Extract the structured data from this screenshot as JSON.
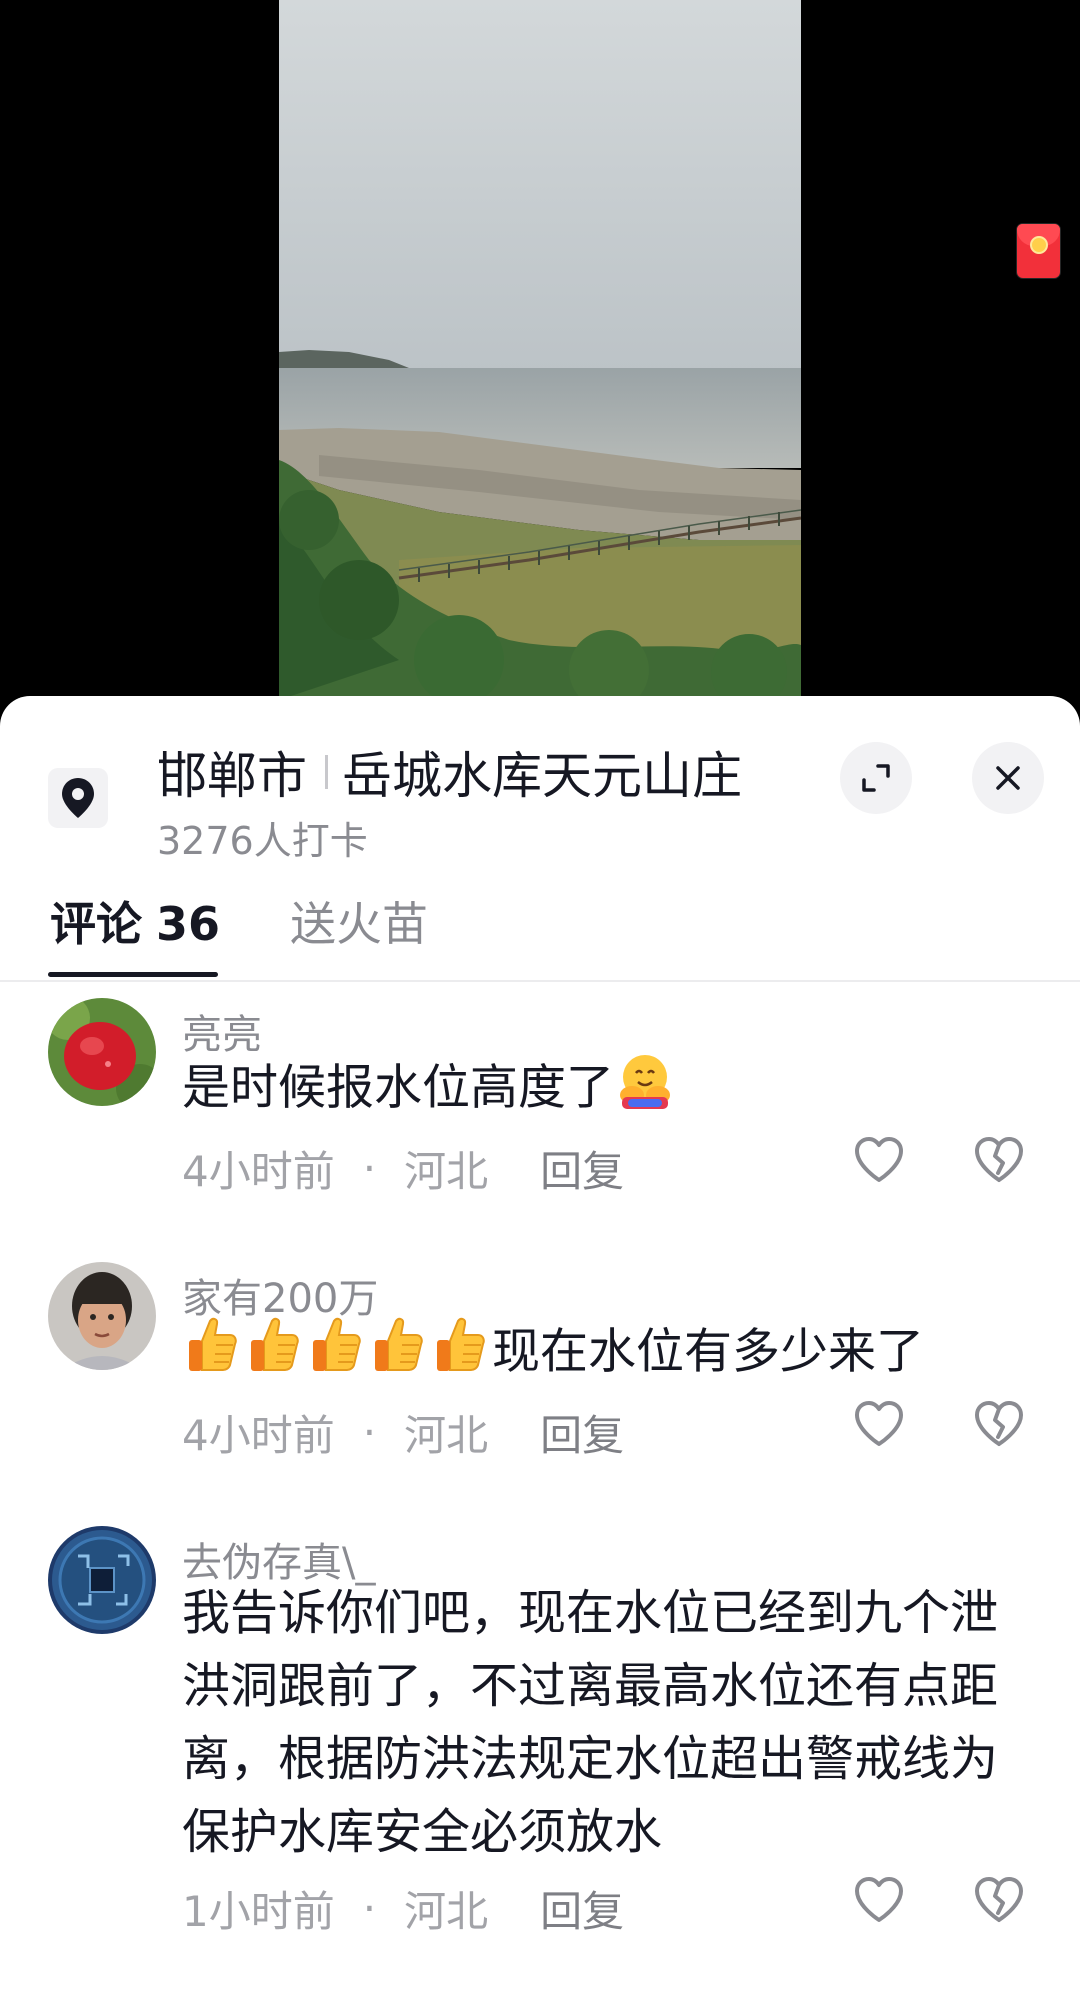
{
  "location": {
    "city": "邯郸市",
    "place": "岳城水库天元山庄",
    "checkins": "3276人打卡",
    "icon": "map-pin-icon"
  },
  "tabs": {
    "comments_label": "评论",
    "comments_count": "36",
    "gifts_label": "送火苗"
  },
  "comments": [
    {
      "user": "亮亮",
      "text": "是时候报水位高度了",
      "emoji": "hugging-face",
      "time": "4小时前",
      "region": "河北",
      "reply": "回复"
    },
    {
      "user": "家有200万",
      "emoji_prefix": "thumbs-up x5",
      "text": "现在水位有多少来了",
      "time": "4小时前",
      "region": "河北",
      "reply": "回复"
    },
    {
      "user": "去伪存真\\_",
      "text": "我告诉你们吧，现在水位已经到九个泄洪洞跟前了，不过离最高水位还有点距离，根据防洪法规定水位超出警戒线为保护水库安全必须放水",
      "time": "1小时前",
      "region": "河北",
      "reply": "回复"
    }
  ],
  "colors": {
    "text_primary": "#161823",
    "text_secondary": "#8a8b91",
    "sheet_bg": "#ffffff",
    "red_packet": "#f2303a"
  }
}
